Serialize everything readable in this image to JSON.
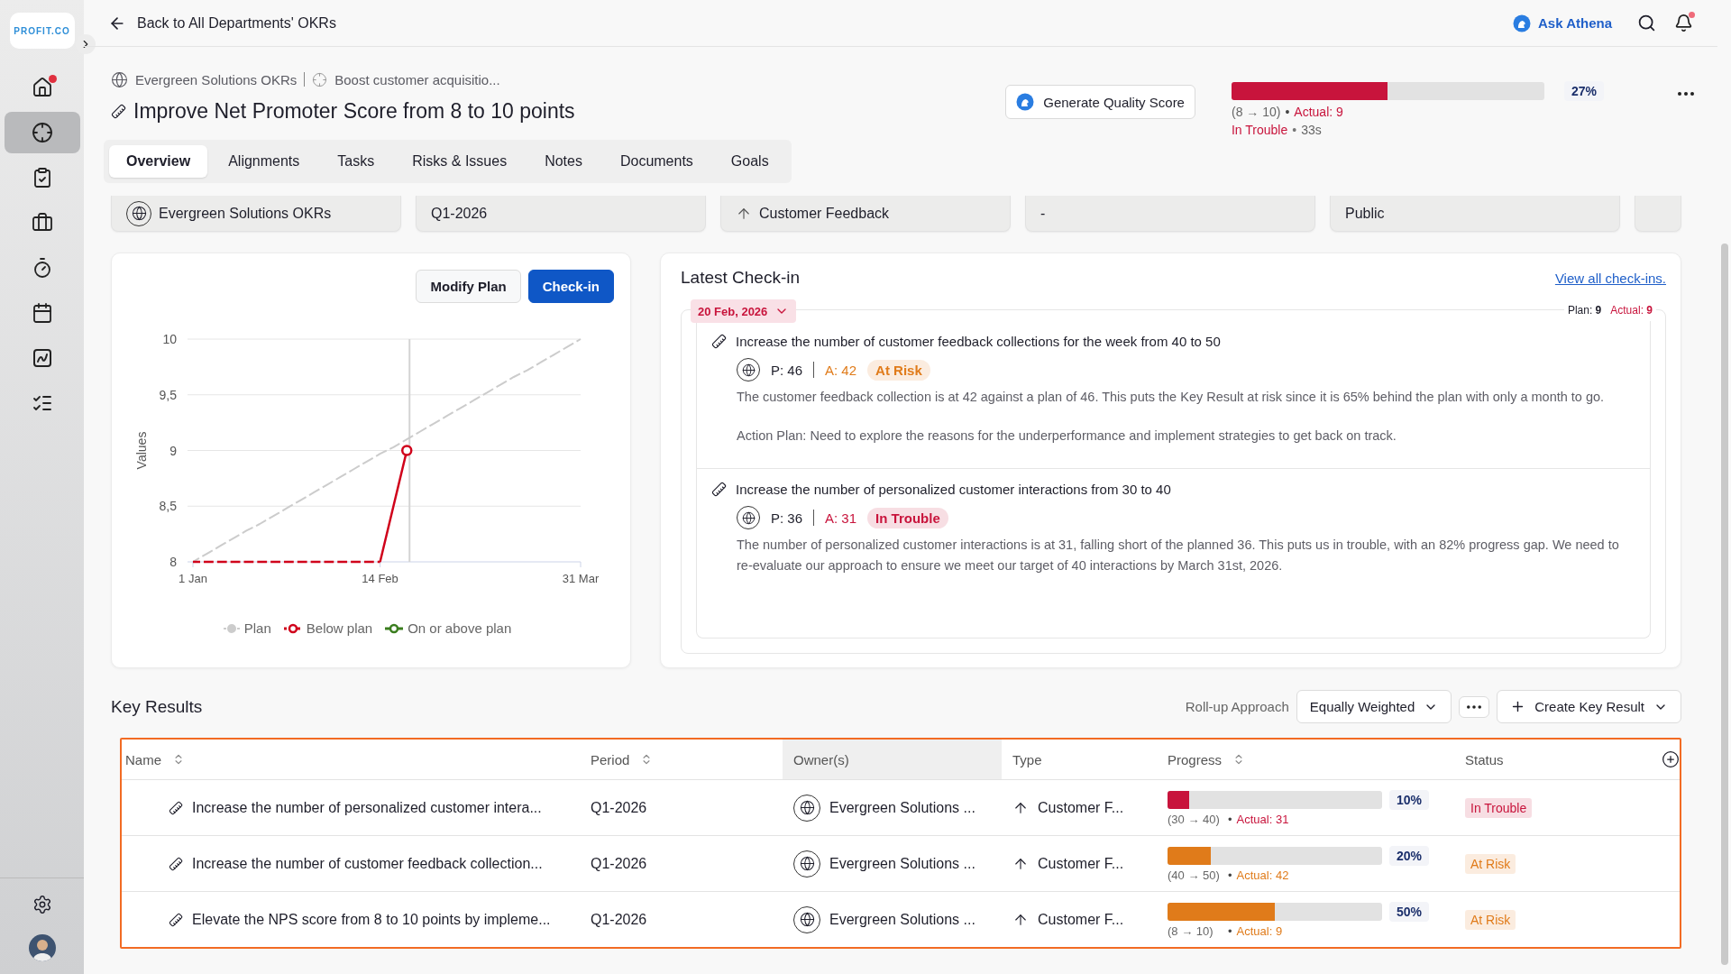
{
  "sidebar": {
    "logo": "PROFIT.CO",
    "items": [
      {
        "selected": false,
        "alert": true
      },
      {
        "selected": true,
        "alert": false
      },
      {
        "selected": false,
        "alert": false
      },
      {
        "selected": false,
        "alert": false
      },
      {
        "selected": false,
        "alert": false
      },
      {
        "selected": false,
        "alert": false
      },
      {
        "selected": false,
        "alert": false
      },
      {
        "selected": false,
        "alert": false
      }
    ]
  },
  "topbar": {
    "back_link": "Back to All Departments' OKRs",
    "assistant": "Ask Athena",
    "notifications_alert": true
  },
  "header": {
    "breadcrumb": [
      "Evergreen Solutions OKRs",
      "Boost customer acquisitio..."
    ],
    "title": "Improve Net Promoter Score from 8 to 10 points",
    "quality_button": "Generate Quality Score",
    "progress": {
      "level": 0.5,
      "percent": "27%",
      "range": "(8 → 10)",
      "actual": "Actual: 9",
      "status": "In Trouble",
      "updated": "33s",
      "separators": [
        "•",
        "•"
      ],
      "color": "#c8143c"
    }
  },
  "tabs": [
    {
      "label": "Overview",
      "selected": true
    },
    {
      "label": "Alignments",
      "selected": false
    },
    {
      "label": "Tasks",
      "selected": false
    },
    {
      "label": "Risks & Issues",
      "selected": false
    },
    {
      "label": "Notes",
      "selected": false
    },
    {
      "label": "Documents",
      "selected": false
    },
    {
      "label": "Goals",
      "selected": false
    }
  ],
  "info_cards": [
    {
      "kind": "owner",
      "text": "Evergreen Solutions OKRs"
    },
    {
      "kind": "plain",
      "text": "Q1-2026"
    },
    {
      "kind": "type",
      "text": "Customer Feedback"
    },
    {
      "kind": "plain",
      "text": "-"
    },
    {
      "kind": "plain",
      "text": "Public"
    },
    {
      "kind": "empty"
    }
  ],
  "plan_chart": {
    "buttons": [
      "Modify Plan",
      "Check-in"
    ],
    "chart_data": {
      "type": "line",
      "ylabel": "Values",
      "categories": [
        "1 Jan",
        null,
        null,
        null,
        null,
        null,
        null,
        null,
        null,
        null,
        null,
        null,
        null,
        null,
        "14 Feb",
        null,
        null,
        null,
        null,
        null,
        null,
        null,
        null,
        null,
        null,
        null,
        null,
        null,
        null,
        "31 Mar"
      ],
      "series": [
        {
          "name": "Plan",
          "color": "#cccccc",
          "line_style": "dashed",
          "values": [
            8,
            8.07,
            8.14,
            8.21,
            8.28,
            8.34,
            8.41,
            8.48,
            8.55,
            8.62,
            8.69,
            8.76,
            8.83,
            8.9,
            8.97,
            9.03,
            9.1,
            9.17,
            9.24,
            9.31,
            9.38,
            9.45,
            9.52,
            9.59,
            9.66,
            9.72,
            9.79,
            9.86,
            9.93,
            10
          ]
        },
        {
          "name": "Below plan",
          "color": "#d0021b",
          "line_style": "dashed",
          "values": [
            8,
            8,
            8,
            8,
            8,
            8,
            8,
            8,
            8,
            8,
            8,
            8,
            8,
            8,
            8,
            8.5,
            9,
            null,
            null,
            null,
            null,
            null,
            null,
            null,
            null,
            null,
            null,
            null,
            null,
            null
          ]
        },
        {
          "name": "On or above plan",
          "color": "#3a7d1e",
          "line_style": "solid",
          "values": [
            null,
            null,
            null,
            null,
            null,
            null,
            null,
            null,
            null,
            null,
            null,
            null,
            null,
            null,
            null,
            null,
            null,
            null,
            null,
            null,
            null,
            null,
            null,
            null,
            null,
            null,
            null,
            null,
            null,
            null
          ]
        }
      ],
      "ylim": [
        8,
        10
      ],
      "grid": true,
      "yticks": [
        {
          "value": 8,
          "label": "8"
        },
        {
          "value": 8.5,
          "label": "8,5"
        },
        {
          "value": 9,
          "label": "9"
        },
        {
          "value": 9.5,
          "label": "9,5"
        },
        {
          "value": 10,
          "label": "10"
        }
      ]
    }
  },
  "latest_checkin": {
    "title": "Latest Check-in",
    "link": "View all check-ins.",
    "date": "20 Feb, 2026",
    "plan": "Plan: **9**",
    "actual": "Actual: **9**",
    "items": [
      {
        "title": "Increase the number of customer feedback collections for the week from 40 to 50",
        "plan": "P: 46",
        "actual": "A: 42",
        "status": "At Risk",
        "color": "#e07b1a",
        "paragraphs": [
          "The customer feedback collection is at 42 against a plan of 46. This puts the Key Result at risk since it is 65% behind the plan with only a month to go.",
          "Action Plan: Need to explore the reasons for the underperformance and implement strategies to get back on track."
        ]
      },
      {
        "title": "Increase the number of personalized customer interactions from 30 to 40",
        "plan": "P: 36",
        "actual": "A: 31",
        "status": "In Trouble",
        "color": "#c8143c",
        "paragraphs": [
          "The number of personalized customer interactions is at 31, falling short of the planned 36. This puts us in trouble, with an 82% progress gap. We need to re-evaluate our approach to ensure we meet our target of 40 interactions by March 31st, 2026."
        ]
      }
    ]
  },
  "key_results": {
    "title": "Key Results",
    "rollup_label": "Roll-up Approach",
    "rollup_value": "Equally Weighted",
    "create_button": "Create Key Result",
    "columns": [
      {
        "label": "Name",
        "sortable": true,
        "highlighted": false
      },
      {
        "label": "Period",
        "sortable": true,
        "highlighted": false
      },
      {
        "label": "Owner(s)",
        "sortable": false,
        "highlighted": true
      },
      {
        "label": "Type",
        "sortable": false,
        "highlighted": false
      },
      {
        "label": "Progress",
        "sortable": true,
        "highlighted": false
      },
      {
        "label": "Status",
        "sortable": false,
        "highlighted": false
      }
    ],
    "rows": [
      {
        "name": "Increase the number of personalized customer intera...",
        "period": "Q1-2026",
        "owner": "Evergreen Solutions ...",
        "type": "Customer F...",
        "level": 0.1,
        "percent": "10%",
        "range": "(30 → 40)",
        "separator": "•",
        "actual": "Actual: 31",
        "status": "In Trouble",
        "color": "#c8143c"
      },
      {
        "name": "Increase the number of customer feedback collection...",
        "period": "Q1-2026",
        "owner": "Evergreen Solutions ...",
        "type": "Customer F...",
        "level": 0.2,
        "percent": "20%",
        "range": "(40 → 50)",
        "separator": "•",
        "actual": "Actual: 42",
        "status": "At Risk",
        "color": "#e07b1a"
      },
      {
        "name": "Elevate the NPS score from 8 to 10 points by impleme...",
        "period": "Q1-2026",
        "owner": "Evergreen Solutions ...",
        "type": "Customer F...",
        "level": 0.5,
        "percent": "50%",
        "range": "(8 → 10)",
        "separator": "•",
        "actual": "Actual: 9",
        "status": "At Risk",
        "color": "#e07b1a"
      }
    ]
  }
}
